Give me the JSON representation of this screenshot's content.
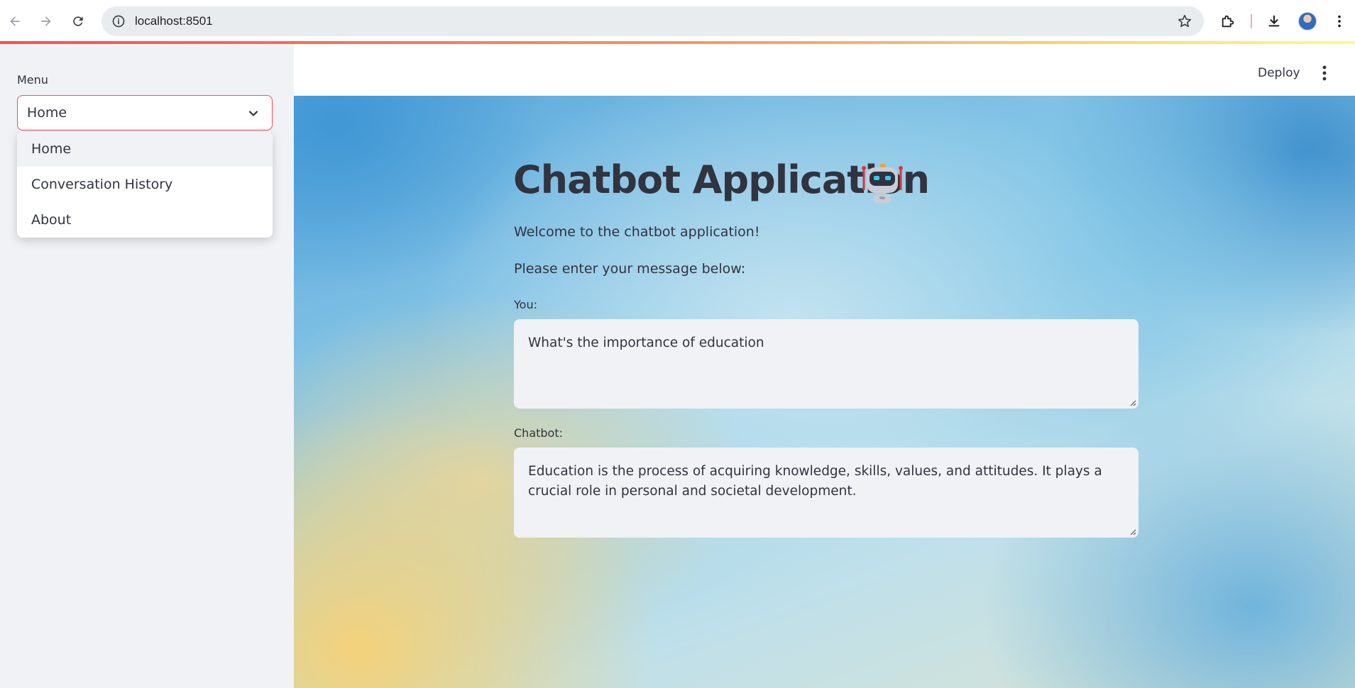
{
  "browser": {
    "url": "localhost:8501",
    "icons": [
      "back-icon",
      "forward-icon",
      "reload-icon",
      "site-info-icon",
      "bookmark-star-icon",
      "extensions-icon",
      "download-icon",
      "profile-avatar",
      "chrome-menu-icon"
    ]
  },
  "app": {
    "accent_color": "#ff4b4b",
    "deploy_label": "Deploy"
  },
  "sidebar": {
    "menu_label": "Menu",
    "selected": "Home",
    "options": [
      "Home",
      "Conversation History",
      "About"
    ]
  },
  "main": {
    "title": "Chatbot Application",
    "title_icon": "robot-icon",
    "welcome": "Welcome to the chatbot application!",
    "prompt": "Please enter your message below:",
    "you_label": "You:",
    "you_value": "What's the importance of education",
    "chatbot_label": "Chatbot:",
    "chatbot_value": "Education is the process of acquiring knowledge, skills, values, and attitudes. It plays a crucial role in personal and societal development."
  }
}
